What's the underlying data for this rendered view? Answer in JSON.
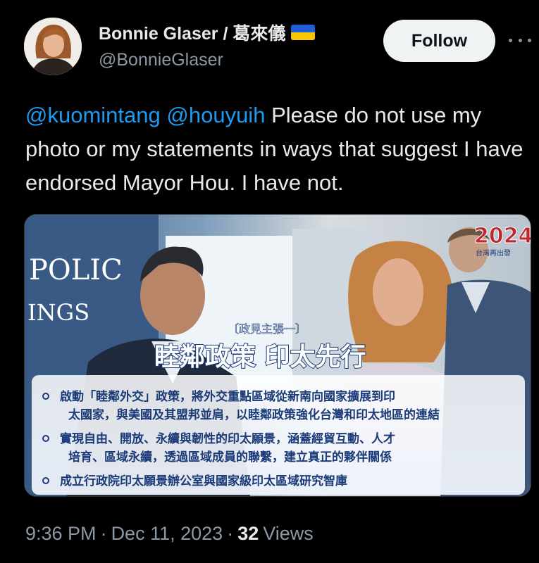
{
  "author": {
    "display_name": "Bonnie Glaser / 葛來儀",
    "handle": "@BonnieGlaser",
    "flag_icon": "ukraine-flag-icon",
    "flag_colors": [
      "#1f5fd6",
      "#f7c600"
    ]
  },
  "follow_button": {
    "label": "Follow"
  },
  "more_icon": "more-horizontal-icon",
  "tweet": {
    "mention_1": "@kuomintang",
    "mention_2": "@houyuih",
    "body": "Please do not use my photo or my statements in ways that suggest I have endorsed Mayor Hou. I have not."
  },
  "media": {
    "backdrop_text_1": "POLIC",
    "backdrop_text_2": "INGS",
    "badge_year": "2024",
    "badge_subtitle": "台灣再出發",
    "subtitle": "〔政見主張一〕",
    "headline": "睦鄰政策 印太先行",
    "bullets": [
      [
        "啟動「睦鄰外交」政策，將外交重點區域從新南向國家擴展到印",
        "太國家，與美國及其盟邦並肩，以睦鄰政策強化台灣和印太地區的連結"
      ],
      [
        "實現自由、開放、永續與韌性的印太願景，涵蓋經貿互動、人才",
        "培育、區域永續，透過區域成員的聯繫，建立真正的夥伴關係"
      ],
      [
        "成立行政院印太願景辦公室與國家級印太區域研究智庫"
      ]
    ]
  },
  "meta": {
    "time": "9:36 PM",
    "separator": "·",
    "date": "Dec 11, 2023",
    "views_count": "32",
    "views_label": "Views"
  },
  "colors": {
    "background": "#000000",
    "text": "#e7e9ea",
    "muted": "#8b98a5",
    "link": "#1d9bf0"
  }
}
